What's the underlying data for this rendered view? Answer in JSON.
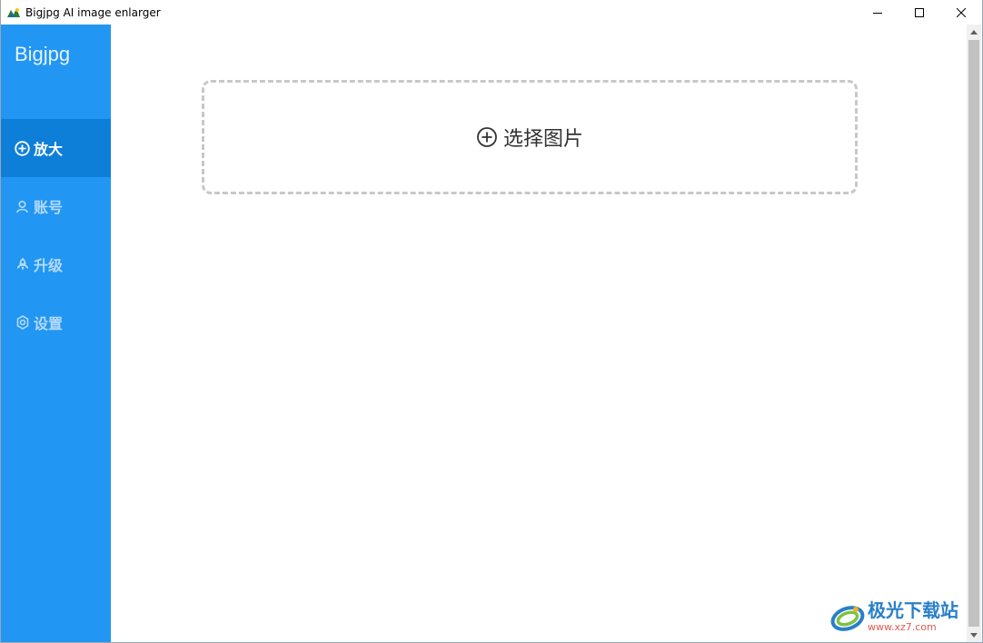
{
  "window": {
    "title": "Bigjpg AI image enlarger"
  },
  "sidebar": {
    "brand": "Bigjpg",
    "items": [
      {
        "label": "放大",
        "icon": "plus-circle-icon",
        "active": true
      },
      {
        "label": "账号",
        "icon": "user-icon",
        "active": false
      },
      {
        "label": "升级",
        "icon": "rocket-icon",
        "active": false
      },
      {
        "label": "设置",
        "icon": "gear-icon",
        "active": false
      }
    ]
  },
  "main": {
    "dropzone": {
      "label": "选择图片",
      "icon": "plus-circle-icon"
    }
  },
  "watermark": {
    "name": "极光下载站",
    "url": "www.xz7.com"
  },
  "colors": {
    "sidebar_bg": "#2196f3",
    "sidebar_active_bg": "#0e7fd9",
    "dropzone_border": "#c8c8c8"
  }
}
